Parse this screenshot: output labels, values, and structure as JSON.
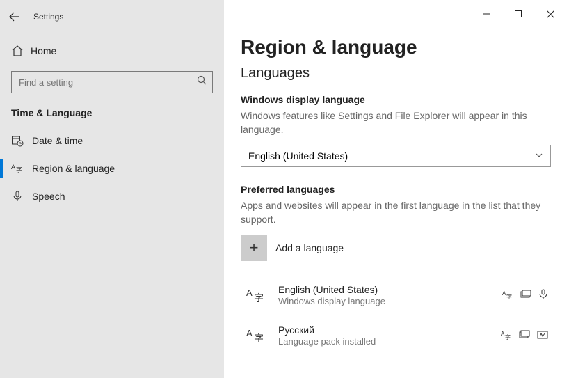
{
  "window": {
    "title": "Settings"
  },
  "sidebar": {
    "home": "Home",
    "search_placeholder": "Find a setting",
    "section": "Time & Language",
    "items": [
      {
        "label": "Date & time"
      },
      {
        "label": "Region & language"
      },
      {
        "label": "Speech"
      }
    ]
  },
  "main": {
    "title": "Region & language",
    "languages_heading": "Languages",
    "display_lang_heading": "Windows display language",
    "display_lang_desc": "Windows features like Settings and File Explorer will appear in this language.",
    "display_lang_selected": "English (United States)",
    "preferred_heading": "Preferred languages",
    "preferred_desc": "Apps and websites will appear in the first language in the list that they support.",
    "add_language": "Add a language",
    "langs": [
      {
        "name": "English (United States)",
        "sub": "Windows display language"
      },
      {
        "name": "Русский",
        "sub": "Language pack installed"
      }
    ]
  }
}
